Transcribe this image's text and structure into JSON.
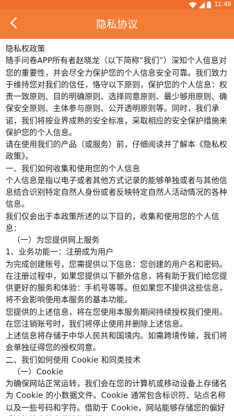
{
  "status_bar": {
    "time": "11:48",
    "icons": [
      "wifi-icon",
      "signal-icon",
      "battery-icon"
    ],
    "color": "#f06f2c"
  },
  "app_bar": {
    "title": "隐私协议",
    "back_icon": "chevron-left-icon",
    "color": "#f57c35"
  },
  "content": {
    "paragraphs": [
      "隐私权政策",
      "随手问卷APP所有者赵晓龙（以下简称“我们”）深知个人信息对您的重要性，并会尽全力保护您的个人信息安全可靠。我们致力于维持您对我们的信任，恪守以下原则，保护您的个人信息：权责一致原则、目的明确原则、选择同意原则、最少够用原则、确保安全原则、主体参与原则、公开透明原则等。同时，我们承诺，我们将按业界成熟的安全标准，采取相应的安全保护措施来保护您的个人信息。",
      "请在使用我们的产品（或服务）前，仔细阅读并了解本《隐私权政策》。",
      "一、我们如何收集和使用您的个人信息",
      "个人信息是指以电子或者其他方式记录的能够单独或者与其他信息结合识别特定自然人身份或者反映特定自然人活动情况的各种信息。",
      "我们仅会出于本政策所述的以下目的，收集和使用您的个人信息：",
      "（一）为您提供网上服务",
      "1、业务功能一：注册成为用户",
      "为完成创建账号，您需提供以下信息：您创建的用户名和密码。",
      "在注册过程中，如果您提供以下额外信息，将有助于我们给您提供更好的服务和体验：手机号等等。但如果您不提供这些信息，将不会影响使用本服务的基本功能。",
      "您提供的上述信息，将在您使用本服务期间持续授权我们使用。在您注销账号时，我们将停止使用并删除上述信息。",
      "上述信息将存储于中华人民共和国境内。如需跨境传输，我们将会单独征得您的授权同意。",
      "二、我们如何使用 Cookie 和同类技术",
      "（一）Cookie",
      "为确保网站正常运转，我们会在您的计算机或移动设备上存储名为 Cookie 的小数据文件。Cookie 通常包含标识符、站点名称以及一些号码和字符。借助于 Cookie，网站能够存储您的偏好或购物篮内的商品等数据。"
    ]
  }
}
